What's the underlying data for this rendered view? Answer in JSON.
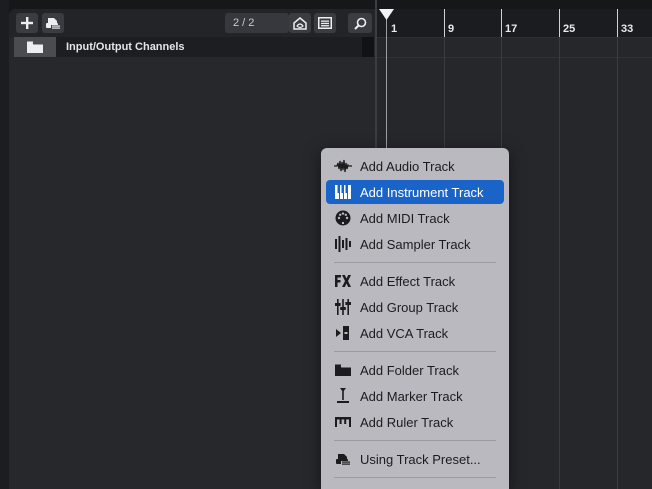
{
  "toolbar": {
    "add_track_icon": "plus-icon",
    "presets_icon": "track-preset-icon",
    "counter": "2 / 2",
    "visibility_icon": "visibility-icon",
    "list_icon": "list-icon",
    "search_icon": "search-icon"
  },
  "track": {
    "name": "Input/Output Channels",
    "icon": "folder-icon"
  },
  "ruler": {
    "bars": [
      "1",
      "9",
      "17",
      "25",
      "33"
    ]
  },
  "menu": {
    "items": [
      {
        "label": "Add Audio Track",
        "icon": "audio-waveform-icon"
      },
      {
        "label": "Add Instrument Track",
        "icon": "piano-keys-icon",
        "selected": true
      },
      {
        "label": "Add MIDI Track",
        "icon": "midi-plug-icon"
      },
      {
        "label": "Add Sampler Track",
        "icon": "sampler-icon"
      },
      {
        "label": "Add Effect Track",
        "icon": "fx-icon"
      },
      {
        "label": "Add Group Track",
        "icon": "group-faders-icon"
      },
      {
        "label": "Add VCA Track",
        "icon": "vca-icon"
      },
      {
        "label": "Add Folder Track",
        "icon": "folder-icon"
      },
      {
        "label": "Add Marker Track",
        "icon": "marker-icon"
      },
      {
        "label": "Add Ruler Track",
        "icon": "ruler-icon"
      },
      {
        "label": "Using Track Preset...",
        "icon": "track-preset-icon"
      }
    ]
  },
  "colors": {
    "selection": "#1a64c9",
    "menu_background": "#b9b9bf",
    "panel_background": "#26282c"
  }
}
